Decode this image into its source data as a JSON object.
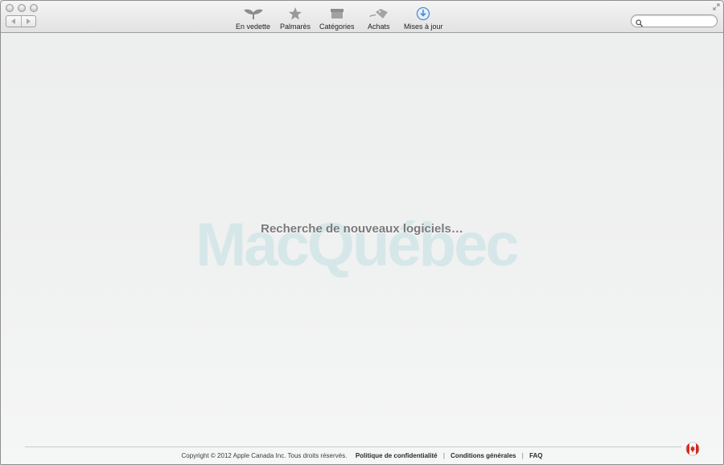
{
  "toolbar": {
    "tabs": [
      {
        "label": "En vedette",
        "icon": "featured-icon"
      },
      {
        "label": "Palmarès",
        "icon": "star-icon"
      },
      {
        "label": "Catégories",
        "icon": "box-icon"
      },
      {
        "label": "Achats",
        "icon": "tag-icon"
      },
      {
        "label": "Mises à jour",
        "icon": "download-icon"
      }
    ],
    "search": {
      "value": "",
      "placeholder": ""
    }
  },
  "content": {
    "loading_text": "Recherche de nouveaux logiciels…",
    "watermark": "MacQuébec"
  },
  "footer": {
    "copyright": "Copyright © 2012 Apple Canada Inc. Tous droits réservés.",
    "links": [
      "Politique de confidentialité",
      "Conditions générales",
      "FAQ"
    ],
    "separator": "|"
  },
  "colors": {
    "accent_blue": "#4a8bd6",
    "flag_red": "#d52b1e",
    "watermark": "#d6e7e9"
  }
}
